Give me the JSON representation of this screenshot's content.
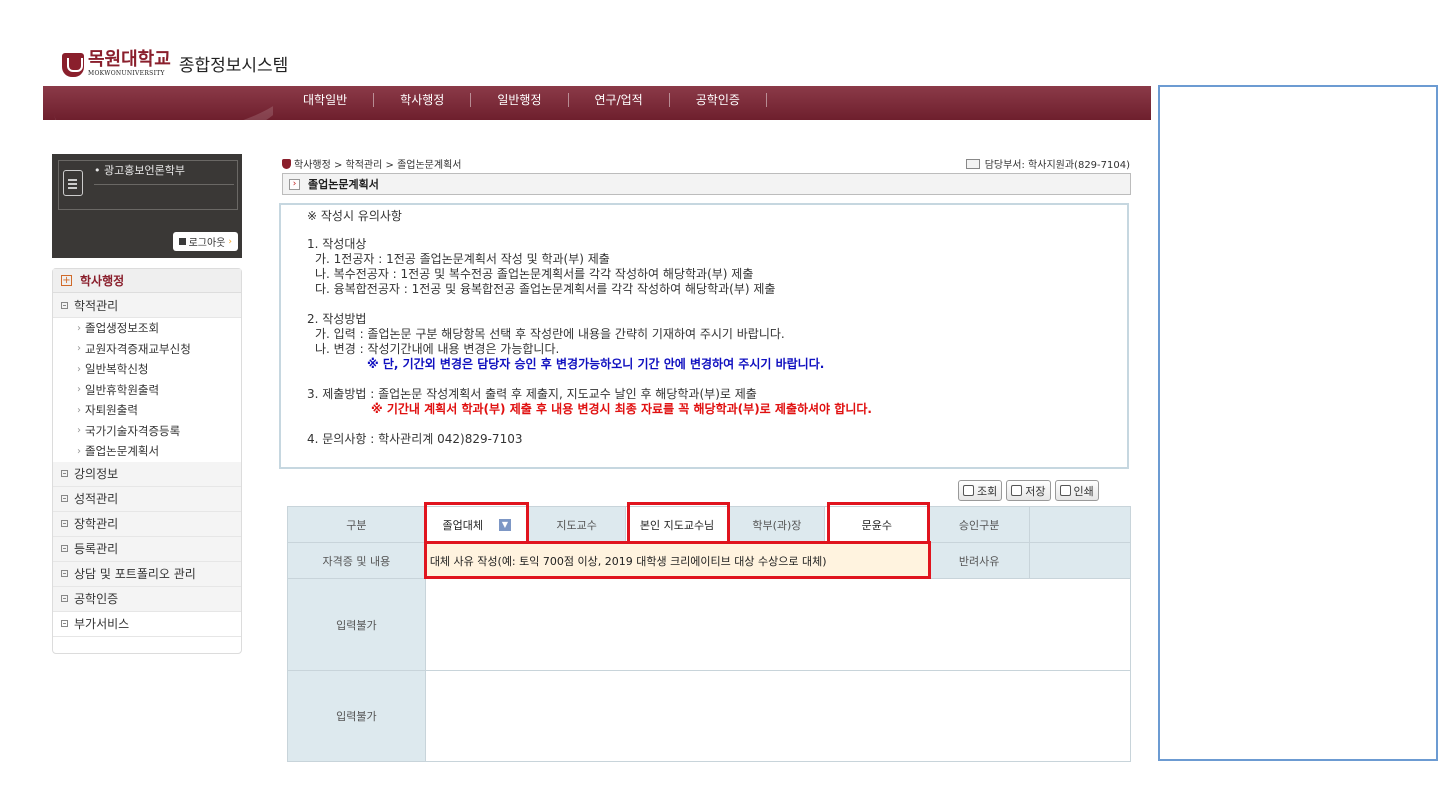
{
  "header": {
    "logo_name": "목원대학교",
    "logo_en": "MOKWONUNIVERSITY",
    "system_name": "종합정보시스템"
  },
  "top_menu": [
    "대학일반",
    "학사행정",
    "일반행정",
    "연구/업적",
    "공학인증"
  ],
  "user": {
    "dept": "광고홍보언론학부",
    "logout_label": "로그아웃"
  },
  "sidebar": {
    "title": "학사행정",
    "sections": [
      {
        "label": "학적관리",
        "items": [
          "졸업생정보조회",
          "교원자격증재교부신청",
          "일반복학신청",
          "일반휴학원출력",
          "자퇴원출력",
          "국가기술자격증등록",
          "졸업논문계획서"
        ]
      },
      {
        "label": "강의정보"
      },
      {
        "label": "성적관리"
      },
      {
        "label": "장학관리"
      },
      {
        "label": "등록관리"
      },
      {
        "label": "상담 및 포트폴리오 관리"
      },
      {
        "label": "공학인증"
      },
      {
        "label": "부가서비스"
      }
    ]
  },
  "breadcrumb": "학사행정 > 학적관리 > 졸업논문계획서",
  "dept_info": "담당부서: 학사지원과(829-7104)",
  "page_title": "졸업논문계획서",
  "notice": {
    "title": "※ 작성시 유의사항",
    "s1_title": "1. 작성대상",
    "s1_a": "가. 1전공자  : 1전공 졸업논문계획서 작성 및 학과(부) 제출",
    "s1_b": "나. 복수전공자 : 1전공 및 복수전공 졸업논문계획서를 각각 작성하여 해당학과(부) 제출",
    "s1_c": "다. 융복합전공자 : 1전공 및 융복합전공 졸업논문계획서를 각각 작성하여 해당학과(부) 제출",
    "s2_title": "2. 작성방법",
    "s2_a": "가. 입력 : 졸업논문 구분 해당항목 선택 후 작성란에 내용을 간략히 기재하여 주시기 바랍니다.",
    "s2_b": "나. 변경 : 작성기간내에 내용 변경은 가능합니다.",
    "s2_blue": "※ 단, 기간외 변경은 담당자 승인 후 변경가능하오니 기간 안에 변경하여 주시기 바랍니다.",
    "s3_title": "3. 제출방법 : 졸업논문 작성계획서 출력 후  제출지, 지도교수 날인 후 해당학과(부)로 제출",
    "s3_red": "※ 기간내 계획서 학과(부) 제출 후 내용 변경시 최종 자료를 꼭 해당학과(부)로 제출하셔야 합니다.",
    "s4": "4. 문의사항 : 학사관리계 042)829-7103"
  },
  "buttons": {
    "search": "조회",
    "save": "저장",
    "print": "인쇄"
  },
  "form": {
    "type_label": "구분",
    "type_value": "졸업대체",
    "advisor_label": "지도교수",
    "advisor_value": "본인 지도교수님",
    "head_label": "학부(과)장",
    "head_value": "문윤수",
    "approval_label": "승인구분",
    "approval_value": "",
    "cert_label": "자격증 및 내용",
    "cert_value": "대체 사유 작성(예: 토익 700점 이상, 2019 대학생 크리에이티브 대상 수상으로 대체)",
    "reject_label": "반려사유",
    "reject_value": "",
    "input1_label": "입력불가",
    "input2_label": "입력불가"
  },
  "colors": {
    "brand": "#8a1f2c",
    "highlight": "#e0141e",
    "notice_blue": "#1010c0",
    "notice_red": "#e01010",
    "panel_border": "#6c9bd2"
  }
}
